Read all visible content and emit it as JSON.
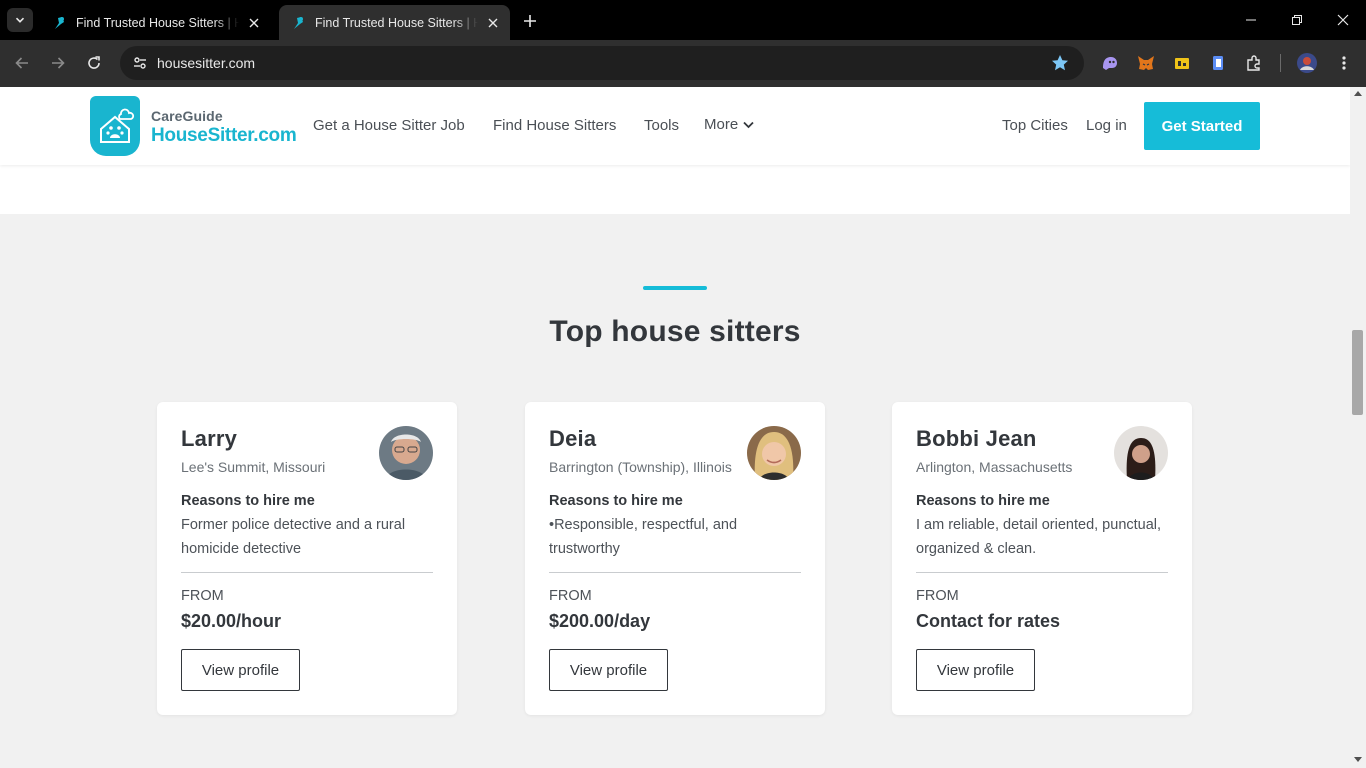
{
  "browser": {
    "tabs": [
      {
        "title": "Find Trusted House Sitters | House",
        "active": false
      },
      {
        "title": "Find Trusted House Sitters | House",
        "active": true
      }
    ],
    "url": "housesitter.com"
  },
  "header": {
    "logo_top": "CareGuide",
    "logo_main": "HouseSitter.com",
    "nav": [
      "Get a House Sitter Job",
      "Find House Sitters",
      "Tools",
      "More"
    ],
    "right_links": [
      "Top Cities",
      "Log in"
    ],
    "cta": "Get Started"
  },
  "section": {
    "title": "Top house sitters"
  },
  "sitters": [
    {
      "name": "Larry",
      "location": "Lee's Summit, Missouri",
      "reasons_heading": "Reasons to hire me",
      "reasons": "Former  police detective and a rural homicide detective",
      "from_label": "FROM",
      "rate": "$20.00/hour",
      "button": "View profile"
    },
    {
      "name": "Deia",
      "location": "Barrington (Township), Illinois",
      "reasons_heading": "Reasons to hire me",
      "reasons": "•Responsible, respectful, and trustworthy",
      "from_label": "FROM",
      "rate": "$200.00/day",
      "button": "View profile"
    },
    {
      "name": "Bobbi Jean",
      "location": "Arlington, Massachusetts",
      "reasons_heading": "Reasons to hire me",
      "reasons": "I am reliable, detail oriented, punctual, organized & clean.",
      "from_label": "FROM",
      "rate": "Contact for rates",
      "button": "View profile"
    }
  ],
  "colors": {
    "brand": "#16bcd8",
    "text_dark": "#33373c",
    "page_bg": "#f1f1f1"
  }
}
